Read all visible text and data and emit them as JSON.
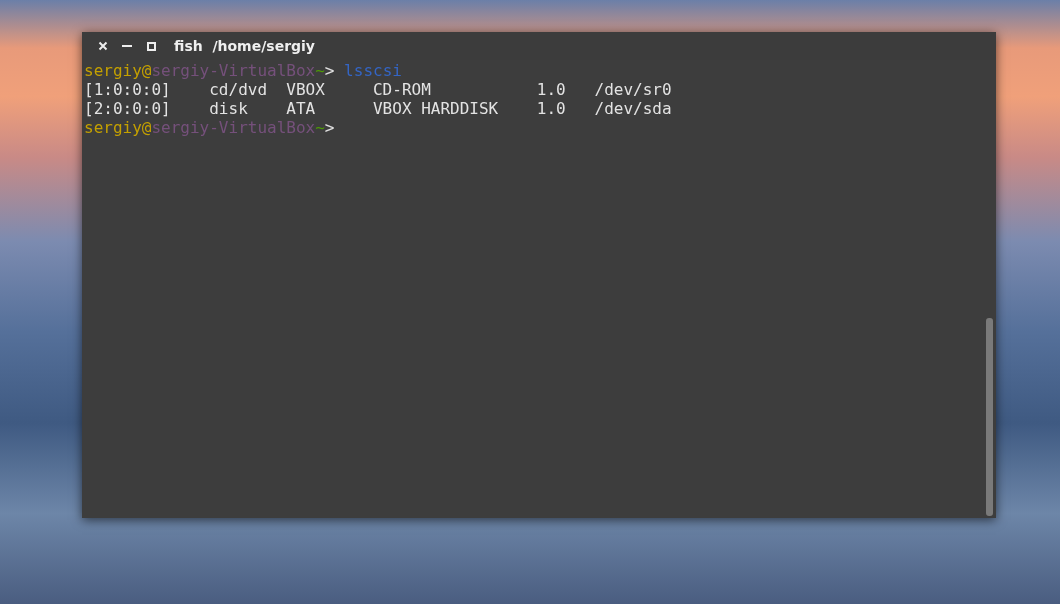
{
  "window": {
    "title": "fish  /home/sergiy"
  },
  "terminal": {
    "lines": [
      {
        "kind": "prompt",
        "user": "sergiy@",
        "host": "sergiy-VirtualBox",
        "tilde": "~",
        "arrow": ">",
        "command": " lsscsi"
      },
      {
        "kind": "output",
        "text": "[1:0:0:0]    cd/dvd  VBOX     CD-ROM           1.0   /dev/sr0"
      },
      {
        "kind": "output",
        "text": "[2:0:0:0]    disk    ATA      VBOX HARDDISK    1.0   /dev/sda"
      },
      {
        "kind": "prompt",
        "user": "sergiy@",
        "host": "sergiy-VirtualBox",
        "tilde": "~",
        "arrow": ">"
      }
    ]
  }
}
